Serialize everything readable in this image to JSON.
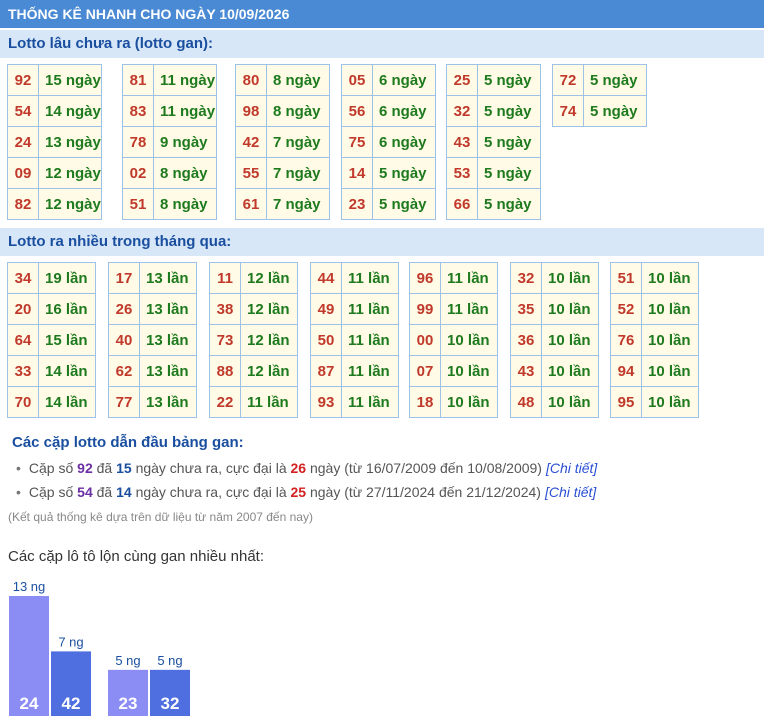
{
  "header": {
    "title": "THỐNG KÊ NHANH CHO NGÀY 10/09/2026"
  },
  "gan": {
    "title": "Lotto lâu chưa ra (lotto gan):",
    "groups": [
      [
        [
          "92",
          "15 ngày"
        ],
        [
          "54",
          "14 ngày"
        ],
        [
          "24",
          "13 ngày"
        ],
        [
          "09",
          "12 ngày"
        ],
        [
          "82",
          "12 ngày"
        ]
      ],
      [
        [
          "81",
          "11 ngày"
        ],
        [
          "83",
          "11 ngày"
        ],
        [
          "78",
          "9 ngày"
        ],
        [
          "02",
          "8 ngày"
        ],
        [
          "51",
          "8 ngày"
        ]
      ],
      [
        [
          "80",
          "8 ngày"
        ],
        [
          "98",
          "8 ngày"
        ],
        [
          "42",
          "7 ngày"
        ],
        [
          "55",
          "7 ngày"
        ],
        [
          "61",
          "7 ngày"
        ]
      ],
      [
        [
          "05",
          "6 ngày"
        ],
        [
          "56",
          "6 ngày"
        ],
        [
          "75",
          "6 ngày"
        ],
        [
          "14",
          "5 ngày"
        ],
        [
          "23",
          "5 ngày"
        ]
      ],
      [
        [
          "25",
          "5 ngày"
        ],
        [
          "32",
          "5 ngày"
        ],
        [
          "43",
          "5 ngày"
        ],
        [
          "53",
          "5 ngày"
        ],
        [
          "66",
          "5 ngày"
        ]
      ],
      [
        [
          "72",
          "5 ngày"
        ],
        [
          "74",
          "5 ngày"
        ]
      ]
    ]
  },
  "nhieu": {
    "title": "Lotto ra nhiều trong tháng qua:",
    "groups": [
      [
        [
          "34",
          "19 lần"
        ],
        [
          "20",
          "16 lần"
        ],
        [
          "64",
          "15 lần"
        ],
        [
          "33",
          "14 lần"
        ],
        [
          "70",
          "14 lần"
        ]
      ],
      [
        [
          "17",
          "13 lần"
        ],
        [
          "26",
          "13 lần"
        ],
        [
          "40",
          "13 lần"
        ],
        [
          "62",
          "13 lần"
        ],
        [
          "77",
          "13 lần"
        ]
      ],
      [
        [
          "11",
          "12 lần"
        ],
        [
          "38",
          "12 lần"
        ],
        [
          "73",
          "12 lần"
        ],
        [
          "88",
          "12 lần"
        ],
        [
          "22",
          "11 lần"
        ]
      ],
      [
        [
          "44",
          "11 lần"
        ],
        [
          "49",
          "11 lần"
        ],
        [
          "50",
          "11 lần"
        ],
        [
          "87",
          "11 lần"
        ],
        [
          "93",
          "11 lần"
        ]
      ],
      [
        [
          "96",
          "11 lần"
        ],
        [
          "99",
          "11 lần"
        ],
        [
          "00",
          "10 lần"
        ],
        [
          "07",
          "10 lần"
        ],
        [
          "18",
          "10 lần"
        ]
      ],
      [
        [
          "32",
          "10 lần"
        ],
        [
          "35",
          "10 lần"
        ],
        [
          "36",
          "10 lần"
        ],
        [
          "43",
          "10 lần"
        ],
        [
          "48",
          "10 lần"
        ]
      ],
      [
        [
          "51",
          "10 lần"
        ],
        [
          "52",
          "10 lần"
        ],
        [
          "76",
          "10 lần"
        ],
        [
          "94",
          "10 lần"
        ],
        [
          "95",
          "10 lần"
        ]
      ]
    ]
  },
  "pairs": {
    "title": "Các cặp lotto dẫn đầu bảng gan:",
    "items": [
      {
        "prefix": "Cặp số",
        "num": "92",
        "mid1": "đã",
        "days": "15",
        "mid2": "ngày chưa ra, cực đại là",
        "max": "26",
        "suffix": "ngày (từ 16/07/2009 đến 10/08/2009)",
        "link": "[Chi tiết]"
      },
      {
        "prefix": "Cặp số",
        "num": "54",
        "mid1": "đã",
        "days": "14",
        "mid2": "ngày chưa ra, cực đại là",
        "max": "25",
        "suffix": "ngày (từ 27/11/2024 đến 21/12/2024)",
        "link": "[Chi tiết]"
      }
    ],
    "note": "(Kết quả thống kê dựa trên dữ liệu từ năm 2007 đến nay)"
  },
  "chart_title": "Các cặp lô tô lộn cùng gan nhiều nhất:",
  "chart_data": {
    "type": "bar",
    "groups": [
      {
        "bars": [
          {
            "label": "24",
            "value": 13,
            "text": "13 ng",
            "color": "#8c8cf5"
          },
          {
            "label": "42",
            "value": 7,
            "text": "7 ng",
            "color": "#4f6fe0"
          }
        ]
      },
      {
        "bars": [
          {
            "label": "23",
            "value": 5,
            "text": "5 ng",
            "color": "#8c8cf5"
          },
          {
            "label": "32",
            "value": 5,
            "text": "5 ng",
            "color": "#4f6fe0"
          }
        ]
      }
    ],
    "ylim": [
      0,
      13
    ]
  }
}
